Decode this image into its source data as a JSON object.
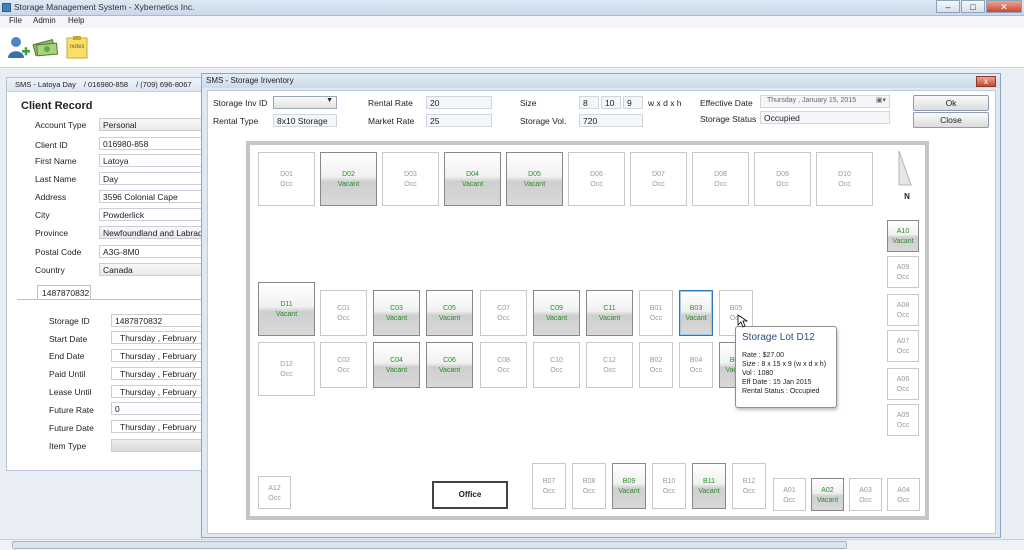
{
  "window": {
    "title": "Storage Management System - Xybernetics Inc."
  },
  "menu": [
    "File",
    "Admin",
    "Help"
  ],
  "toolbar_icons": [
    "add-client-icon",
    "money-icon",
    "notes-icon"
  ],
  "toolbar_notes_label": "notes",
  "client": {
    "crumb": [
      "SMS - Latoya Day",
      "016980-858",
      "(709) 696-8067"
    ],
    "title": "Client Record",
    "fields": [
      {
        "label": "Account Type",
        "value": "Personal"
      },
      {
        "label": "Client ID",
        "value": "016980-858"
      },
      {
        "label": "First Name",
        "value": "Latoya"
      },
      {
        "label": "Last Name",
        "value": "Day"
      },
      {
        "label": "Address",
        "value": "3596 Colonial Cape"
      },
      {
        "label": "City",
        "value": "Powderlick"
      },
      {
        "label": "Province",
        "value": "Newfoundland and Labrador"
      },
      {
        "label": "Postal Code",
        "value": "A3G-8M0"
      },
      {
        "label": "Country",
        "value": "Canada"
      }
    ],
    "tab": "1487870832",
    "storage_fields": [
      {
        "label": "Storage ID",
        "value": "1487870832"
      },
      {
        "label": "Start Date",
        "value": "Thursday  ,  February"
      },
      {
        "label": "End Date",
        "value": "Thursday  ,  February"
      },
      {
        "label": "Paid Until",
        "value": "Thursday  ,  February"
      },
      {
        "label": "Lease Until",
        "value": "Thursday  ,  February"
      },
      {
        "label": "Future Rate",
        "value": "0"
      },
      {
        "label": "Future Date",
        "value": "Thursday  ,  February"
      },
      {
        "label": "Item Type",
        "value": ""
      }
    ]
  },
  "dialog": {
    "title": "SMS - Storage Inventory",
    "close_x": "x",
    "storage_inv_id_label": "Storage Inv ID",
    "storage_inv_id_value": "",
    "rental_type_label": "Rental Type",
    "rental_type_value": "8x10 Storage",
    "rental_rate_label": "Rental Rate",
    "rental_rate_value": "20",
    "market_rate_label": "Market Rate",
    "market_rate_value": "25",
    "size_label": "Size",
    "size_w": "8",
    "size_d": "10",
    "size_h": "9",
    "size_units": "w x d x h",
    "storage_vol_label": "Storage Vol.",
    "storage_vol_value": "720",
    "effective_date_label": "Effective Date",
    "effective_date_value": "Thursday  ,  January  15, 2015",
    "storage_status_label": "Storage Status",
    "storage_status_value": "Occupied",
    "ok_label": "Ok",
    "close_label": "Close"
  },
  "lots": [
    {
      "id": "D01",
      "status": "Occ"
    },
    {
      "id": "D02",
      "status": "Vacant"
    },
    {
      "id": "D03",
      "status": "Occ"
    },
    {
      "id": "D04",
      "status": "Vacant"
    },
    {
      "id": "D05",
      "status": "Vacant"
    },
    {
      "id": "D06",
      "status": "Occ"
    },
    {
      "id": "D07",
      "status": "Occ"
    },
    {
      "id": "D08",
      "status": "Occ"
    },
    {
      "id": "D09",
      "status": "Occ"
    },
    {
      "id": "D10",
      "status": "Occ"
    },
    {
      "id": "D11",
      "status": "Vacant"
    },
    {
      "id": "D12",
      "status": "Occ"
    },
    {
      "id": "C01",
      "status": "Occ"
    },
    {
      "id": "C02",
      "status": "Occ"
    },
    {
      "id": "C03",
      "status": "Vacant"
    },
    {
      "id": "C04",
      "status": "Vacant"
    },
    {
      "id": "C05",
      "status": "Vacant"
    },
    {
      "id": "C06",
      "status": "Vacant"
    },
    {
      "id": "C07",
      "status": "Occ"
    },
    {
      "id": "C08",
      "status": "Occ"
    },
    {
      "id": "C09",
      "status": "Vacant"
    },
    {
      "id": "C10",
      "status": "Occ"
    },
    {
      "id": "C11",
      "status": "Vacant"
    },
    {
      "id": "C12",
      "status": "Occ"
    },
    {
      "id": "B01",
      "status": "Occ"
    },
    {
      "id": "B02",
      "status": "Occ"
    },
    {
      "id": "B03",
      "status": "Vacant"
    },
    {
      "id": "B04",
      "status": "Occ"
    },
    {
      "id": "B05",
      "status": "Occ"
    },
    {
      "id": "B06",
      "status": "Vacant"
    },
    {
      "id": "A10",
      "status": "Vacant"
    },
    {
      "id": "A09",
      "status": "Occ"
    },
    {
      "id": "A08",
      "status": "Occ"
    },
    {
      "id": "A07",
      "status": "Occ"
    },
    {
      "id": "A06",
      "status": "Occ"
    },
    {
      "id": "A05",
      "status": "Occ"
    },
    {
      "id": "A12",
      "status": "Occ"
    },
    {
      "id": "B07",
      "status": "Occ"
    },
    {
      "id": "B08",
      "status": "Occ"
    },
    {
      "id": "B09",
      "status": "Vacant"
    },
    {
      "id": "B10",
      "status": "Occ"
    },
    {
      "id": "B11",
      "status": "Vacant"
    },
    {
      "id": "B12",
      "status": "Occ"
    },
    {
      "id": "A01",
      "status": "Occ"
    },
    {
      "id": "A02",
      "status": "Vacant"
    },
    {
      "id": "A03",
      "status": "Occ"
    },
    {
      "id": "A04",
      "status": "Occ"
    }
  ],
  "selected_lot": "B03",
  "office_label": "Office",
  "north_label": "N",
  "tooltip": {
    "title": "Storage Lot D12",
    "lines": [
      "Rate : $27.00",
      "Size : 8 x 15 x 9  (w x d x h)",
      "Vol : 1080",
      "Eff Date : 15 Jan 2015",
      "Rental Status : Occupied"
    ]
  },
  "colors": {
    "vacant_text": "#2b8c2b",
    "occ_text": "#999999",
    "title_blue": "#2b4f82"
  }
}
